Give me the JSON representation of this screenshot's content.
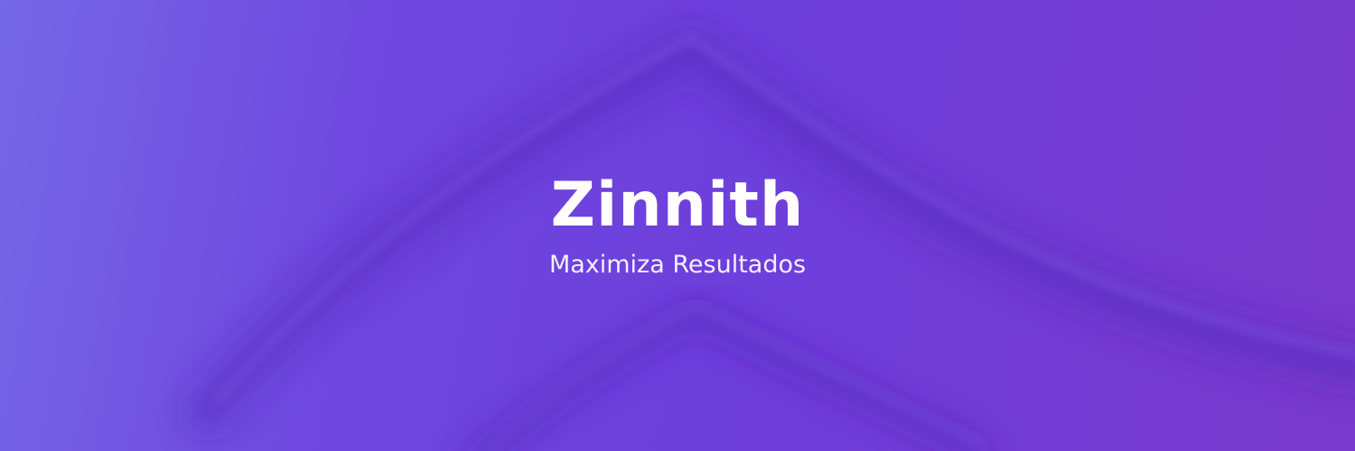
{
  "brand": {
    "name": "Zinnith",
    "tagline": "Maximiza Resultados"
  },
  "colors": {
    "background_left": "#7567e6",
    "background_center": "#6d3fdb",
    "background_right": "#7a3ace",
    "ridge_shadow": "#5a2fc4",
    "ridge_highlight": "#8a66ef",
    "text": "#ffffff"
  }
}
